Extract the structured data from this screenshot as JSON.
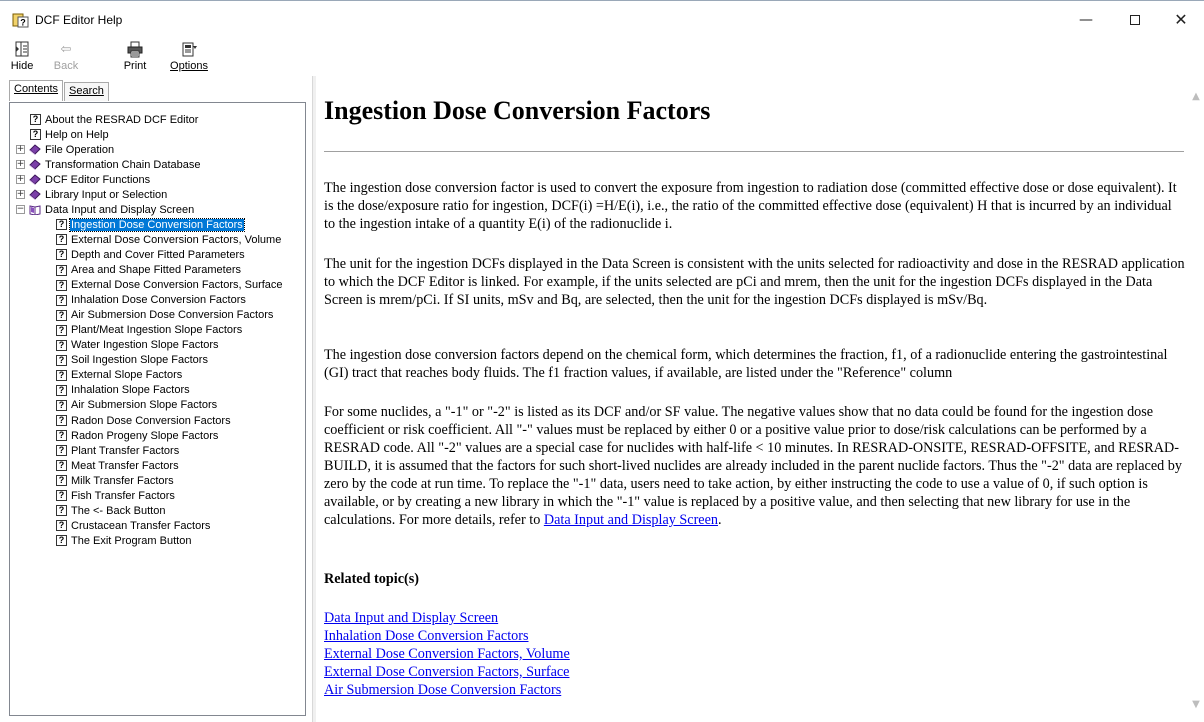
{
  "window": {
    "title": "DCF Editor Help",
    "minimize": "—",
    "close": "✕"
  },
  "toolbar": {
    "hide": "Hide",
    "back": "Back",
    "print": "Print",
    "options": "Options"
  },
  "nav": {
    "tab_contents": "Contents",
    "tab_search": "Search"
  },
  "tree": [
    {
      "label": "About the RESRAD DCF Editor",
      "kind": "topic",
      "level": 1
    },
    {
      "label": "Help on Help",
      "kind": "topic",
      "level": 1
    },
    {
      "label": "File Operation",
      "kind": "book",
      "level": 0,
      "expander": "+"
    },
    {
      "label": "Transformation Chain Database",
      "kind": "book",
      "level": 0,
      "expander": "+"
    },
    {
      "label": "DCF Editor Functions",
      "kind": "book",
      "level": 0,
      "expander": "+"
    },
    {
      "label": "Library Input or Selection",
      "kind": "book",
      "level": 0,
      "expander": "+"
    },
    {
      "label": "Data Input and Display Screen",
      "kind": "openbook",
      "level": 0,
      "expander": "−"
    },
    {
      "label": "Ingestion Dose Conversion Factors",
      "kind": "topic",
      "level": 2,
      "selected": true
    },
    {
      "label": "External Dose Conversion Factors, Volume",
      "kind": "topic",
      "level": 2
    },
    {
      "label": "Depth and Cover Fitted Parameters",
      "kind": "topic",
      "level": 2
    },
    {
      "label": "Area and Shape Fitted Parameters",
      "kind": "topic",
      "level": 2
    },
    {
      "label": "External Dose Conversion Factors, Surface",
      "kind": "topic",
      "level": 2
    },
    {
      "label": "Inhalation Dose Conversion Factors",
      "kind": "topic",
      "level": 2
    },
    {
      "label": "Air Submersion Dose Conversion Factors",
      "kind": "topic",
      "level": 2
    },
    {
      "label": "Plant/Meat Ingestion Slope Factors",
      "kind": "topic",
      "level": 2
    },
    {
      "label": "Water Ingestion Slope Factors",
      "kind": "topic",
      "level": 2
    },
    {
      "label": "Soil Ingestion Slope Factors",
      "kind": "topic",
      "level": 2
    },
    {
      "label": "External Slope Factors",
      "kind": "topic",
      "level": 2
    },
    {
      "label": "Inhalation Slope Factors",
      "kind": "topic",
      "level": 2
    },
    {
      "label": "Air Submersion Slope Factors",
      "kind": "topic",
      "level": 2
    },
    {
      "label": "Radon Dose Conversion Factors",
      "kind": "topic",
      "level": 2
    },
    {
      "label": "Radon Progeny Slope Factors",
      "kind": "topic",
      "level": 2
    },
    {
      "label": "Plant Transfer Factors",
      "kind": "topic",
      "level": 2
    },
    {
      "label": "Meat Transfer Factors",
      "kind": "topic",
      "level": 2
    },
    {
      "label": "Milk Transfer Factors",
      "kind": "topic",
      "level": 2
    },
    {
      "label": "Fish Transfer Factors",
      "kind": "topic",
      "level": 2
    },
    {
      "label": "The <- Back Button",
      "kind": "topic",
      "level": 2
    },
    {
      "label": "Crustacean Transfer Factors",
      "kind": "topic",
      "level": 2
    },
    {
      "label": "The Exit Program Button",
      "kind": "topic",
      "level": 2
    }
  ],
  "article": {
    "title": "Ingestion Dose Conversion Factors",
    "p1": "The ingestion dose conversion factor is used to convert the exposure from ingestion to radiation dose (committed effective dose or dose equivalent). It is the dose/exposure ratio for ingestion, DCF(i) =H/E(i), i.e., the ratio of the committed effective dose (equivalent) H that is incurred by an individual to the ingestion intake of a quantity E(i) of the radionuclide i.",
    "p2": "The unit for the ingestion DCFs displayed in the Data Screen is consistent with the units selected for radioactivity and dose in the RESRAD application to which the DCF Editor is linked. For example, if the units selected are pCi and mrem, then the unit for the ingestion DCFs displayed in the Data Screen is mrem/pCi. If SI units, mSv and Bq, are selected, then the unit for the ingestion DCFs displayed is mSv/Bq.",
    "p3": "The ingestion dose conversion factors depend on the chemical form, which determines the fraction, f1, of a radionuclide entering the gastrointestinal (GI) tract that reaches body fluids. The f1 fraction values, if available, are listed under the \"Reference\" column",
    "p4": "For some nuclides, a \"-1\" or \"-2\" is listed as its DCF and/or SF value. The negative values show that no data could be found for the ingestion dose coefficient or risk coefficient. All \"-\" values must be replaced by either 0 or a positive value prior to dose/risk calculations can be performed by a RESRAD code. All \"-2\" values are a special case for nuclides with half-life < 10 minutes. In RESRAD-ONSITE, RESRAD-OFFSITE, and RESRAD-BUILD, it is assumed that the factors for such short-lived nuclides are already included in the parent nuclide factors. Thus the \"-2\" data are replaced by zero by the code at run time. To replace the \"-1\" data, users need to take action, by either instructing the code to use a value of 0, if such option is available, or by creating a new library in which the \"-1\" value is replaced by a positive value, and then selecting that new library for use in the calculations. For more details, refer to ",
    "p4_link": "Data Input and Display Screen",
    "p4_end": ".",
    "related_heading": "Related topic(s)",
    "related_links": [
      "Data Input and Display Screen",
      "Inhalation Dose Conversion Factors",
      "External Dose Conversion Factors, Volume",
      "External Dose Conversion Factors, Surface",
      "Air Submersion Dose Conversion Factors"
    ]
  }
}
